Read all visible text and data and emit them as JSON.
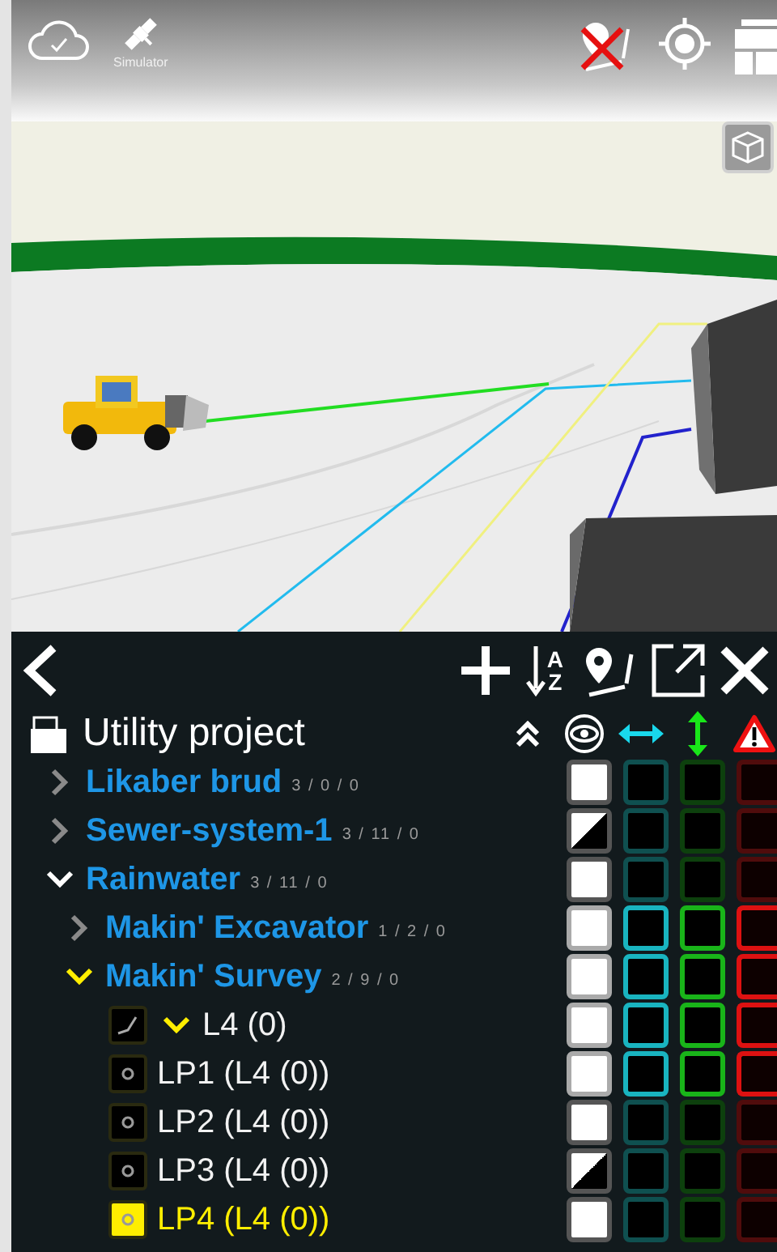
{
  "status_bar": {
    "gps_label": "Simulator"
  },
  "toolbar": {
    "sort_letters": [
      "A",
      "Z"
    ]
  },
  "project": {
    "title": "Utility project"
  },
  "tree": [
    {
      "kind": "group",
      "name": "Likaber brud",
      "counts": "3 / 0 / 0",
      "expanded": false,
      "active": false,
      "selected": false,
      "partially_visible": false,
      "highlighted": false
    },
    {
      "kind": "group",
      "name": "Sewer-system-1",
      "counts": "3 / 11 / 0",
      "expanded": false,
      "active": false,
      "selected": false,
      "partially_visible": true,
      "highlighted": false
    },
    {
      "kind": "group",
      "name": "Rainwater",
      "counts": "3 / 11 / 0",
      "expanded": true,
      "active": false,
      "selected": false,
      "partially_visible": false,
      "highlighted": false,
      "children": [
        {
          "kind": "group",
          "name": "Makin' Excavator",
          "counts": "1 / 2 / 0",
          "expanded": false,
          "active": false,
          "selected": false,
          "partially_visible": false,
          "highlighted": true
        },
        {
          "kind": "group",
          "name": "Makin' Survey",
          "counts": "2 / 9 / 0",
          "expanded": true,
          "active": true,
          "selected": false,
          "partially_visible": false,
          "highlighted": true,
          "children": [
            {
              "kind": "line",
              "name": "L4 (0)",
              "expanded": true,
              "active": true,
              "selected": false,
              "partially_visible": false,
              "highlighted": true,
              "children": [
                {
                  "kind": "point",
                  "name": "LP1 (L4 (0))",
                  "selected": false,
                  "partially_visible": false,
                  "highlighted": true
                },
                {
                  "kind": "point",
                  "name": "LP2 (L4 (0))",
                  "selected": false,
                  "partially_visible": false,
                  "highlighted": false
                },
                {
                  "kind": "point",
                  "name": "LP3 (L4 (0))",
                  "selected": false,
                  "partially_visible": true,
                  "highlighted": false
                },
                {
                  "kind": "point",
                  "name": "LP4 (L4 (0))",
                  "selected": true,
                  "partially_visible": false,
                  "highlighted": false
                }
              ]
            }
          ]
        }
      ]
    }
  ]
}
